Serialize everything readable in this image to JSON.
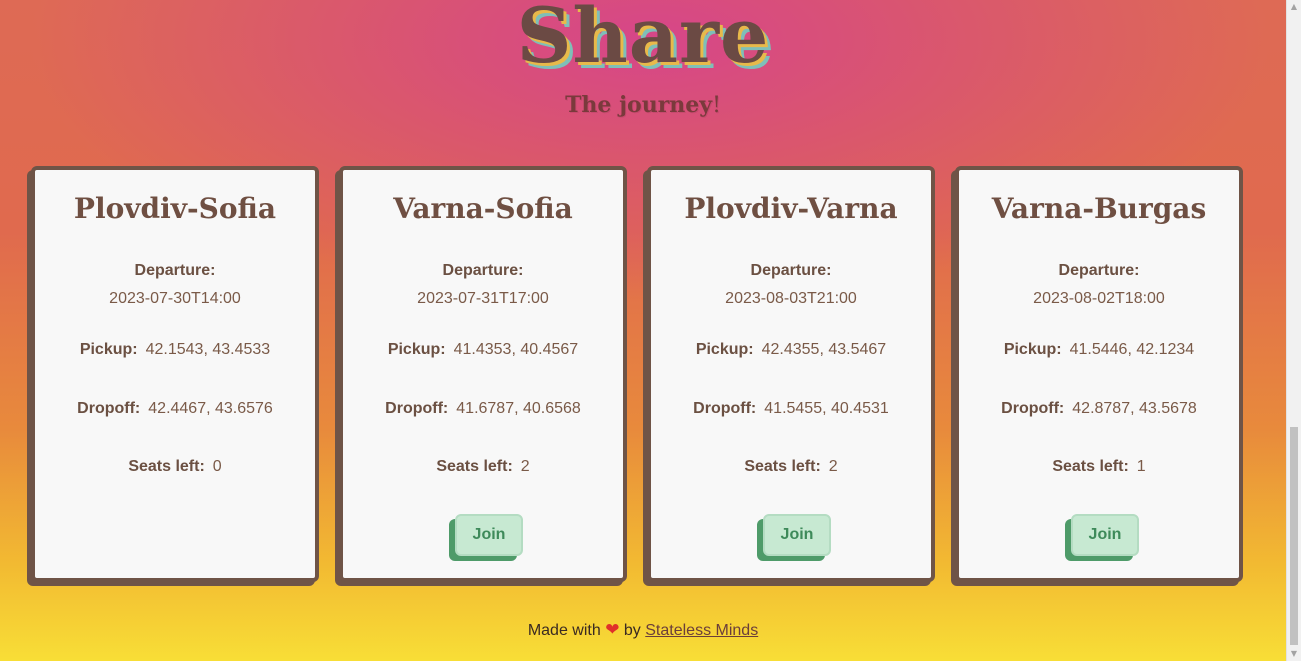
{
  "header": {
    "title": "Share",
    "tagline": "The journey",
    "tagline_suffix": "!"
  },
  "rides": [
    {
      "route": "Plovdiv-Sofia",
      "departure_label": "Departure:",
      "departure": "2023-07-30T14:00",
      "pickup_label": "Pickup:",
      "pickup": "42.1543, 43.4533",
      "dropoff_label": "Dropoff:",
      "dropoff": "42.4467, 43.6576",
      "seats_label": "Seats left:",
      "seats_left": "0"
    },
    {
      "route": "Varna-Sofia",
      "departure_label": "Departure:",
      "departure": "2023-07-31T17:00",
      "pickup_label": "Pickup:",
      "pickup": "41.4353, 40.4567",
      "dropoff_label": "Dropoff:",
      "dropoff": "41.6787, 40.6568",
      "seats_label": "Seats left:",
      "seats_left": "2",
      "join_label": "Join"
    },
    {
      "route": "Plovdiv-Varna",
      "departure_label": "Departure:",
      "departure": "2023-08-03T21:00",
      "pickup_label": "Pickup:",
      "pickup": "42.4355, 43.5467",
      "dropoff_label": "Dropoff:",
      "dropoff": "41.5455, 40.4531",
      "seats_label": "Seats left:",
      "seats_left": "2",
      "join_label": "Join"
    },
    {
      "route": "Varna-Burgas",
      "departure_label": "Departure:",
      "departure": "2023-08-02T18:00",
      "pickup_label": "Pickup:",
      "pickup": "41.5446, 42.1234",
      "dropoff_label": "Dropoff:",
      "dropoff": "42.8787, 43.5678",
      "seats_label": "Seats left:",
      "seats_left": "1",
      "join_label": "Join"
    }
  ],
  "footer": {
    "made_with": "Made with",
    "heart_icon": "heart-icon",
    "by": "by",
    "author_link": "Stateless Minds"
  },
  "colors": {
    "card_border": "#6f5447",
    "join_bg": "#c7e9d2",
    "join_shadow": "#4e9b69",
    "heart": "#e0302a"
  }
}
